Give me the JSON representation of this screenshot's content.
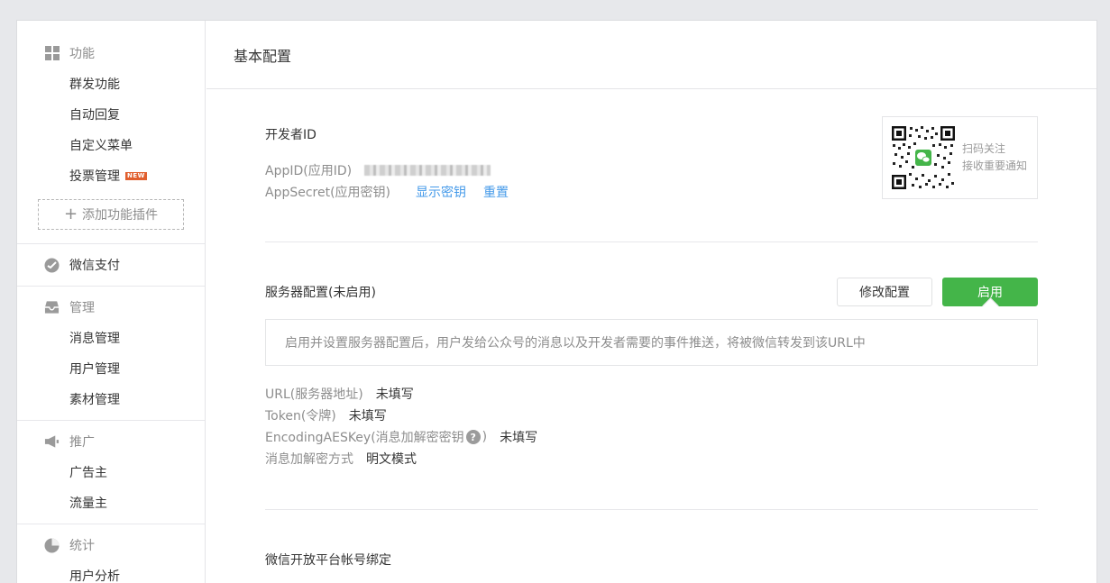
{
  "sidebar": {
    "features": {
      "header": "功能",
      "items": [
        "群发功能",
        "自动回复",
        "自定义菜单",
        "投票管理"
      ],
      "new_badge": "NEW",
      "add_plugin": "添加功能插件"
    },
    "wechat_pay": "微信支付",
    "manage": {
      "header": "管理",
      "items": [
        "消息管理",
        "用户管理",
        "素材管理"
      ]
    },
    "promotion": {
      "header": "推广",
      "items": [
        "广告主",
        "流量主"
      ]
    },
    "stats": {
      "header": "统计",
      "items": [
        "用户分析"
      ]
    }
  },
  "main": {
    "page_title": "基本配置",
    "developer": {
      "title": "开发者ID",
      "appid_label": "AppID(应用ID)",
      "appsecret_label": "AppSecret(应用密钥)",
      "show_secret": "显示密钥",
      "reset": "重置"
    },
    "qr": {
      "line1": "扫码关注",
      "line2": "接收重要通知"
    },
    "server": {
      "title": "服务器配置(未启用)",
      "modify_button": "修改配置",
      "enable_button": "启用",
      "tip": "启用并设置服务器配置后，用户发给公众号的消息以及开发者需要的事件推送，将被微信转发到该URL中",
      "url_label": "URL(服务器地址)",
      "url_value": "未填写",
      "token_label": "Token(令牌)",
      "token_value": "未填写",
      "aes_label_pre": "EncodingAESKey(消息加解密密钥",
      "aes_label_post": ")",
      "help_glyph": "?",
      "aes_value": "未填写",
      "encrypt_label": "消息加解密方式",
      "encrypt_value": "明文模式"
    },
    "open_platform": {
      "title": "微信开放平台帐号绑定"
    }
  },
  "colors": {
    "accent_green": "#44b549",
    "link_blue": "#459ae9",
    "badge_orange": "#e15f2e"
  }
}
